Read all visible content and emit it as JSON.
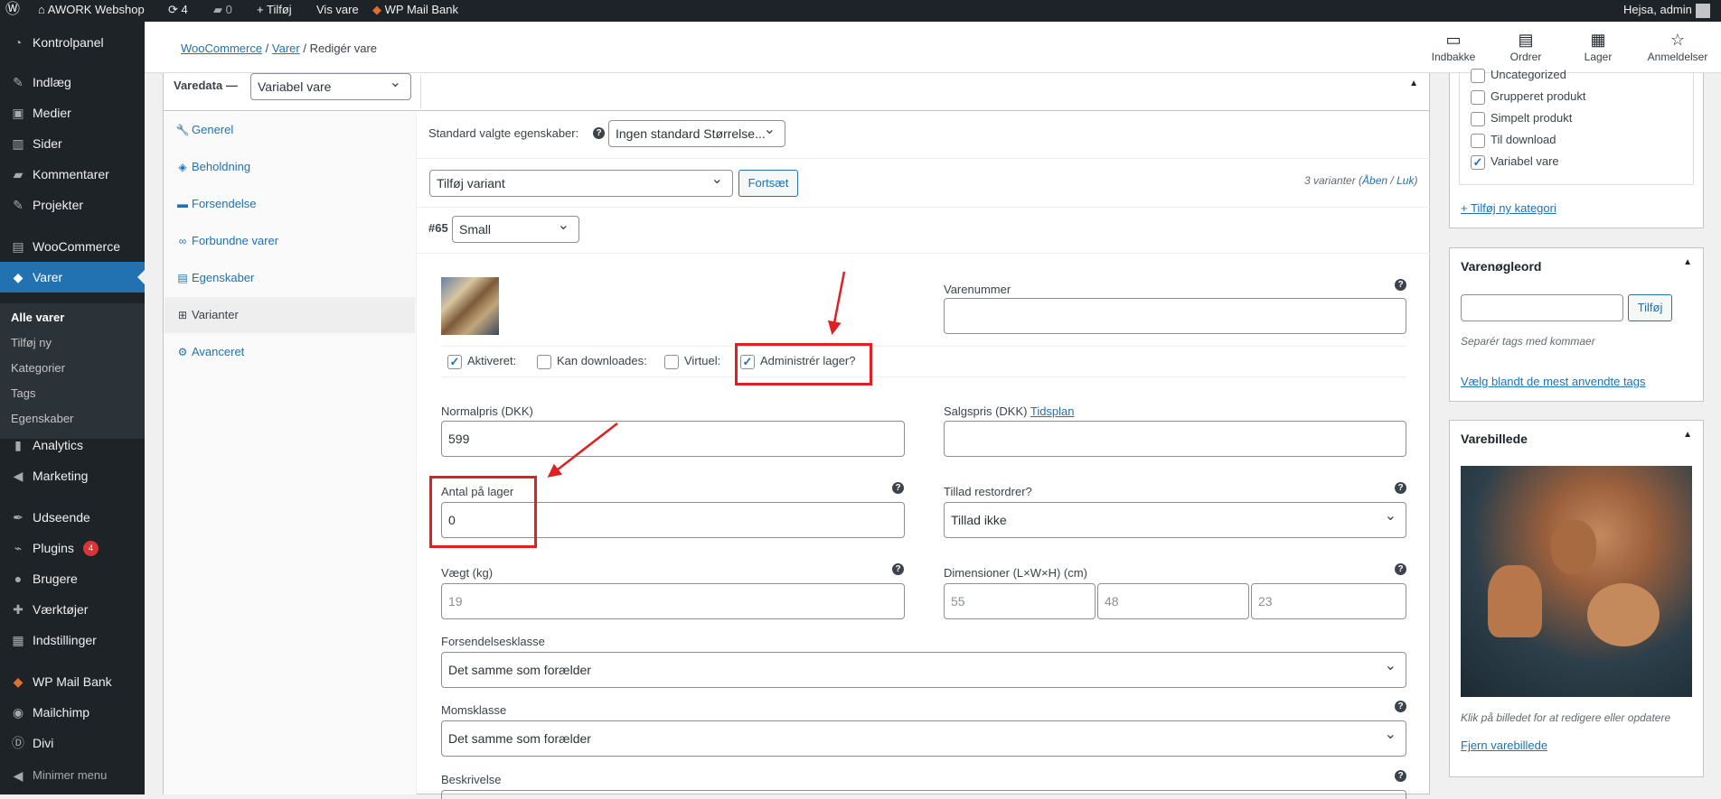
{
  "adminbar": {
    "site_name": "AWORK Webshop",
    "updates_count": "4",
    "comments_count": "0",
    "new_label": "Tilføj",
    "view_label": "Vis vare",
    "wp_mail_bank_label": "WP Mail Bank",
    "greeting": "Hejsa, admin"
  },
  "sidebar": {
    "items": [
      {
        "label": "Kontrolpanel",
        "icon": "dashboard-icon"
      },
      {
        "label": "Indlæg",
        "icon": "pin-icon"
      },
      {
        "label": "Medier",
        "icon": "media-icon"
      },
      {
        "label": "Sider",
        "icon": "pages-icon"
      },
      {
        "label": "Kommentarer",
        "icon": "comments-icon"
      },
      {
        "label": "Projekter",
        "icon": "pin-icon"
      },
      {
        "label": "WooCommerce",
        "icon": "woocommerce-icon"
      },
      {
        "label": "Varer",
        "icon": "products-icon"
      },
      {
        "label": "Analytics",
        "icon": "analytics-icon"
      },
      {
        "label": "Marketing",
        "icon": "megaphone-icon"
      },
      {
        "label": "Udseende",
        "icon": "brush-icon"
      },
      {
        "label": "Plugins",
        "icon": "plugins-icon",
        "badge": "4"
      },
      {
        "label": "Brugere",
        "icon": "users-icon"
      },
      {
        "label": "Værktøjer",
        "icon": "tools-icon"
      },
      {
        "label": "Indstillinger",
        "icon": "settings-icon"
      },
      {
        "label": "WP Mail Bank",
        "icon": "mail-bank-icon"
      },
      {
        "label": "Mailchimp",
        "icon": "mailchimp-icon"
      },
      {
        "label": "Divi",
        "icon": "divi-icon"
      },
      {
        "label": "Minimer menu",
        "icon": "collapse-icon"
      }
    ],
    "submenu": [
      "Alle varer",
      "Tilføj ny",
      "Kategorier",
      "Tags",
      "Egenskaber"
    ]
  },
  "header": {
    "breadcrumb": [
      "WooCommerce",
      "Varer",
      "Redigér vare"
    ],
    "buttons": [
      "Indbakke",
      "Ordrer",
      "Lager",
      "Anmeldelser"
    ]
  },
  "product_data": {
    "heading": "Varedata —",
    "type_value": "Variabel vare",
    "tabs": [
      "Generel",
      "Beholdning",
      "Forsendelse",
      "Forbundne varer",
      "Egenskaber",
      "Varianter",
      "Avanceret"
    ],
    "default_attrs_label": "Standard valgte egenskaber:",
    "default_attrs_value": "Ingen standard Størrelse...",
    "add_variant_value": "Tilføj variant",
    "continue_label": "Fortsæt",
    "variant_count": "3 varianter",
    "open_label": "Åben",
    "close_label": "Luk",
    "variation_id": "#65",
    "variation_value": "Small",
    "sku_label": "Varenummer",
    "sku_value": "",
    "checkbox_enabled": "Aktiveret:",
    "checkbox_downloadable": "Kan downloades:",
    "checkbox_virtual": "Virtuel:",
    "checkbox_manage_stock": "Administrér lager?",
    "regular_price_label": "Normalpris (DKK)",
    "regular_price_value": "599",
    "sale_price_label": "Salgspris (DKK)",
    "schedule_label": "Tidsplan",
    "sale_price_value": "",
    "stock_qty_label": "Antal på lager",
    "stock_qty_value": "0",
    "backorders_label": "Tillad restordrer?",
    "backorders_value": "Tillad ikke",
    "weight_label": "Vægt (kg)",
    "weight_placeholder": "19",
    "dimensions_label": "Dimensioner (L×W×H) (cm)",
    "dim_l": "55",
    "dim_w": "48",
    "dim_h": "23",
    "shipping_class_label": "Forsendelsesklasse",
    "shipping_class_value": "Det samme som forælder",
    "tax_class_label": "Momsklasse",
    "tax_class_value": "Det samme som forælder",
    "description_label": "Beskrivelse"
  },
  "categories": {
    "items": [
      {
        "label": "Uncategorized",
        "checked": false
      },
      {
        "label": "Grupperet produkt",
        "checked": false
      },
      {
        "label": "Simpelt produkt",
        "checked": false
      },
      {
        "label": "Til download",
        "checked": false
      },
      {
        "label": "Variabel vare",
        "checked": true
      }
    ],
    "add_link": "+ Tilføj ny kategori"
  },
  "tags": {
    "title": "Varenøgleord",
    "add_button": "Tilføj",
    "hint": "Separér tags med kommaer",
    "choose_link": "Vælg blandt de mest anvendte tags"
  },
  "image_box": {
    "title": "Varebillede",
    "hint": "Klik på billedet for at redigere eller opdatere",
    "remove_link": "Fjern varebillede"
  },
  "colors": {
    "accent": "#2271b1",
    "admin_dark": "#1d2327",
    "annotation_red": "#e02020"
  }
}
